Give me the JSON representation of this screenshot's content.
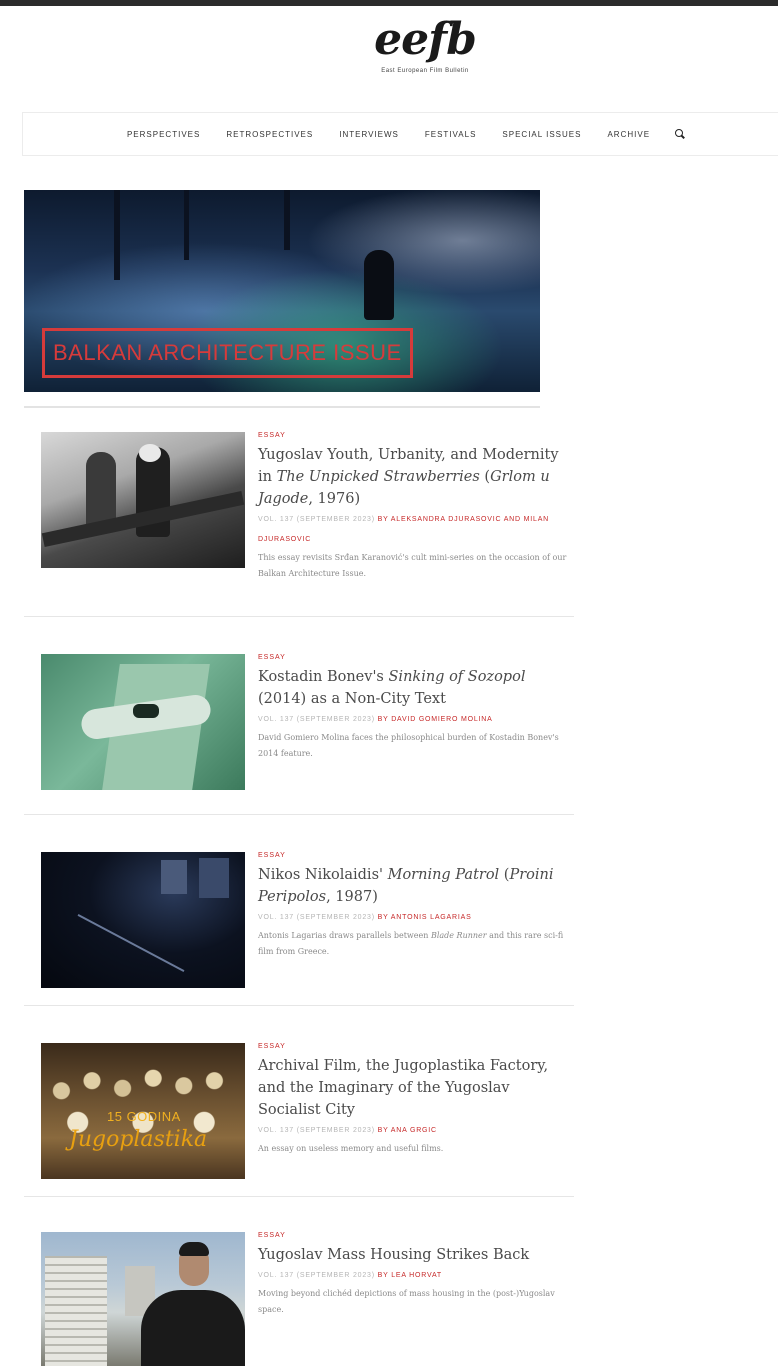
{
  "site": {
    "logo": "eefb",
    "tagline": "East European Film Bulletin"
  },
  "nav": {
    "items": [
      "PERSPECTIVES",
      "RETROSPECTIVES",
      "INTERVIEWS",
      "FESTIVALS",
      "SPECIAL ISSUES",
      "ARCHIVE"
    ],
    "search_icon": "search-icon"
  },
  "hero": {
    "label": "BALKAN ARCHITECTURE ISSUE",
    "label_color": "#d63b3b"
  },
  "colors": {
    "accent": "#c62828",
    "title": "#4a4a4a",
    "meta": "#b5b5b5"
  },
  "articles": [
    {
      "category": "ESSAY",
      "title_plain": "Yugoslav Youth, Urbanity, and Modernity in ",
      "title_italic": "The Unpicked Strawberries",
      "title_plain2": " (",
      "title_italic2": "Grlom u Jagode",
      "title_plain3": ", 1976)",
      "vol": "VOL. 137 (SEPTEMBER 2023)",
      "author": "BY ALEKSANDRA DJURASOVIC AND MILAN DJURASOVIC",
      "excerpt": "This essay revisits Srđan Karanović's cult mini-series on the occasion of our Balkan Architecture Issue."
    },
    {
      "category": "ESSAY",
      "title_plain": "Kostadin Bonev's ",
      "title_italic": "Sinking of Sozopol",
      "title_plain2": " (2014) as a Non-City Text",
      "vol": "VOL. 137 (SEPTEMBER 2023)",
      "author": "BY DAVID GOMIERO MOLINA",
      "excerpt": "David Gomiero Molina faces the philosophical burden of Kostadin Bonev's 2014 feature."
    },
    {
      "category": "ESSAY",
      "title_plain": "Nikos Nikolaidis' ",
      "title_italic": "Morning Patrol",
      "title_plain2": " (",
      "title_italic2": "Proini Peripolos",
      "title_plain3": ", 1987)",
      "vol": "VOL. 137 (SEPTEMBER 2023)",
      "author": "BY ANTONIS LAGARIAS",
      "excerpt_plain": "Antonis Lagarias draws parallels between ",
      "excerpt_italic": "Blade Runner",
      "excerpt_plain2": " and this rare sci-fi film from Greece."
    },
    {
      "category": "ESSAY",
      "title_plain": "Archival Film, the Jugoplastika Factory, and the Imaginary of the Yugoslav Socialist City",
      "vol": "VOL. 137 (SEPTEMBER 2023)",
      "author": "BY ANA GRGIC",
      "excerpt": "An essay on useless memory and useful films.",
      "thumb_caption1": "15 GODINA",
      "thumb_caption2": "Jugoplastika"
    },
    {
      "category": "ESSAY",
      "title_plain": "Yugoslav Mass Housing Strikes Back",
      "vol": "VOL. 137 (SEPTEMBER 2023)",
      "author": "BY LEA HORVAT",
      "excerpt": "Moving beyond clichéd depictions of mass housing in the (post-)Yugoslav space."
    }
  ]
}
